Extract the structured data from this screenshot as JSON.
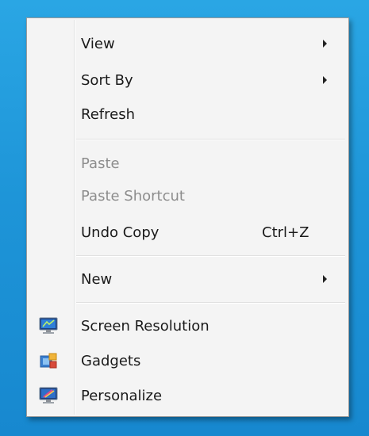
{
  "menu": {
    "view": {
      "label": "View",
      "has_submenu": true
    },
    "sort_by": {
      "label": "Sort By",
      "has_submenu": true
    },
    "refresh": {
      "label": "Refresh"
    },
    "paste": {
      "label": "Paste",
      "enabled": false
    },
    "paste_shortcut": {
      "label": "Paste Shortcut",
      "enabled": false
    },
    "undo_copy": {
      "label": "Undo Copy",
      "shortcut": "Ctrl+Z"
    },
    "new": {
      "label": "New",
      "has_submenu": true
    },
    "screen_resolution": {
      "label": "Screen Resolution",
      "icon": "screen-resolution-icon"
    },
    "gadgets": {
      "label": "Gadgets",
      "icon": "gadgets-icon"
    },
    "personalize": {
      "label": "Personalize",
      "icon": "personalize-icon"
    }
  },
  "colors": {
    "desktop_background": "#1e95d8",
    "menu_background": "#f4f4f4",
    "disabled_text": "#8d8d8d"
  }
}
